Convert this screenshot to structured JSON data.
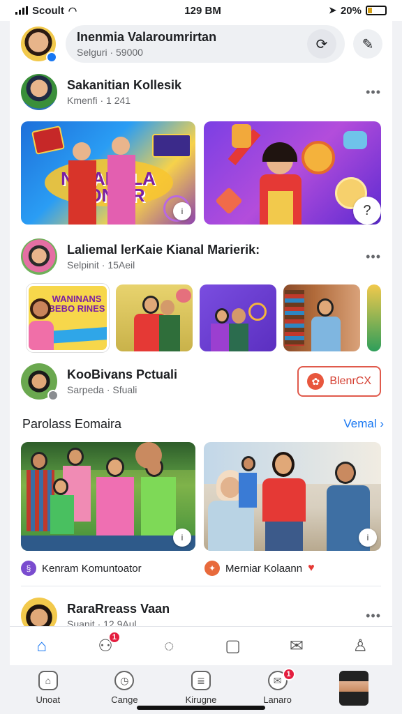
{
  "status": {
    "carrier": "Scoult",
    "time": "129 BM",
    "battery": "20%",
    "signal_icon": "signal-bars-icon",
    "wifi_icon": "wifi-icon"
  },
  "composer": {
    "name": "Inenmia Valaroumrirtan",
    "meta": "Selguri · 59000",
    "refresh_icon": "refresh-icon",
    "edit_icon": "edit-icon"
  },
  "posts": [
    {
      "author": "Sakanitian Kollesik",
      "meta": "Kmenfi · 1 241",
      "more": "•••",
      "images": [
        {
          "caption": "NIBANKLA FIONIER",
          "corner": "i"
        },
        {
          "caption": "",
          "corner": "?"
        }
      ]
    },
    {
      "author": "Laliemal lerKaie Kianal Marierik:",
      "meta": "Selpinit · 15Aeil",
      "more": "•••",
      "thumb_label": "WANINANS BEBO RINES"
    }
  ],
  "suggestion": {
    "author": "KooBivans Pctuali",
    "meta": "Sarpeda · Sfuali",
    "button_label": "BlenrCX"
  },
  "section": {
    "title": "Parolass Eomaira",
    "link": "Vemal ›",
    "cards": [
      {
        "caption": "Kenram Komuntoator",
        "corner": "i",
        "icon_color": "#7a4ccf"
      },
      {
        "caption": "Merniar Kolaann",
        "corner": "i",
        "icon_color": "#e86a3c"
      }
    ]
  },
  "next_post": {
    "author": "RaraRreass Vaan",
    "meta": "Suanit · 12 9Aul",
    "more": "•••"
  },
  "tabs": [
    {
      "name": "home-icon",
      "glyph": "⌂",
      "badge": "",
      "active": true
    },
    {
      "name": "friends-icon",
      "glyph": "⚇",
      "badge": "1",
      "active": false
    },
    {
      "name": "chat-icon",
      "glyph": "◌",
      "badge": "",
      "active": false
    },
    {
      "name": "page-icon",
      "glyph": "▢",
      "badge": "",
      "active": false
    },
    {
      "name": "inbox-icon",
      "glyph": "✉",
      "badge": "",
      "active": false
    },
    {
      "name": "profile-icon",
      "glyph": "♙",
      "badge": "",
      "active": false
    }
  ],
  "bottomnav": [
    {
      "label": "Unoat",
      "glyph": "⌂",
      "badge": ""
    },
    {
      "label": "Cange",
      "glyph": "◷",
      "badge": ""
    },
    {
      "label": "Kirugne",
      "glyph": "≣",
      "badge": ""
    },
    {
      "label": "Lanaro",
      "glyph": "✉",
      "badge": "1"
    }
  ],
  "colors": {
    "accent": "#1877f2",
    "badge": "#e41e3f",
    "action": "#d43d2f"
  }
}
